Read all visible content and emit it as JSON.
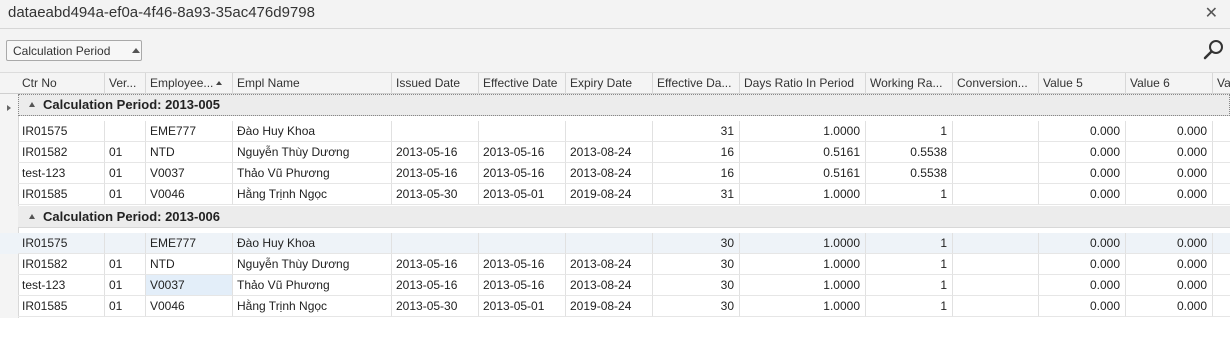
{
  "window": {
    "title": "dataeabd494a-ef0a-4f46-8a93-35ac476d9798",
    "close_glyph": "✕"
  },
  "toolbar": {
    "group_by_chip": "Calculation Period"
  },
  "icons": {
    "search": "search-icon",
    "close": "close-icon"
  },
  "columns": [
    "Ctr No",
    "Ver...",
    "Employee...",
    "Empl Name",
    "Issued Date",
    "Effective Date",
    "Expiry Date",
    "Effective Da...",
    "Days Ratio In Period",
    "Working Ra...",
    "Conversion...",
    "Value 5",
    "Value 6",
    "Va"
  ],
  "groups": [
    {
      "label": "Calculation Period: 2013-005",
      "rows": [
        [
          "IR01575",
          "",
          "EME777",
          "Đào Huy Khoa",
          "",
          "",
          "",
          "31",
          "1.0000",
          "1",
          "",
          "0.000",
          "0.000"
        ],
        [
          "IR01582",
          "01",
          "NTD",
          "Nguyễn Thùy  Dương",
          "2013-05-16",
          "2013-05-16",
          "2013-08-24",
          "16",
          "0.5161",
          "0.5538",
          "",
          "0.000",
          "0.000"
        ],
        [
          "test-123",
          "01",
          "V0037",
          "Thảo  Vũ Phương",
          "2013-05-16",
          "2013-05-16",
          "2013-08-24",
          "16",
          "0.5161",
          "0.5538",
          "",
          "0.000",
          "0.000"
        ],
        [
          "IR01585",
          "01",
          "V0046",
          "Hằng  Trịnh Ngọc",
          "2013-05-30",
          "2013-05-01",
          "2019-08-24",
          "31",
          "1.0000",
          "1",
          "",
          "0.000",
          "0.000"
        ]
      ]
    },
    {
      "label": "Calculation Period: 2013-006",
      "rows": [
        [
          "IR01575",
          "",
          "EME777",
          "Đào Huy Khoa",
          "",
          "",
          "",
          "30",
          "1.0000",
          "1",
          "",
          "0.000",
          "0.000"
        ],
        [
          "IR01582",
          "01",
          "NTD",
          "Nguyễn Thùy  Dương",
          "2013-05-16",
          "2013-05-16",
          "2013-08-24",
          "30",
          "1.0000",
          "1",
          "",
          "0.000",
          "0.000"
        ],
        [
          "test-123",
          "01",
          "V0037",
          "Thảo  Vũ Phương",
          "2013-05-16",
          "2013-05-16",
          "2013-08-24",
          "30",
          "1.0000",
          "1",
          "",
          "0.000",
          "0.000"
        ],
        [
          "IR01585",
          "01",
          "V0046",
          "Hằng  Trịnh Ngọc",
          "2013-05-30",
          "2013-05-01",
          "2019-08-24",
          "30",
          "1.0000",
          "1",
          "",
          "0.000",
          "0.000"
        ]
      ]
    }
  ]
}
